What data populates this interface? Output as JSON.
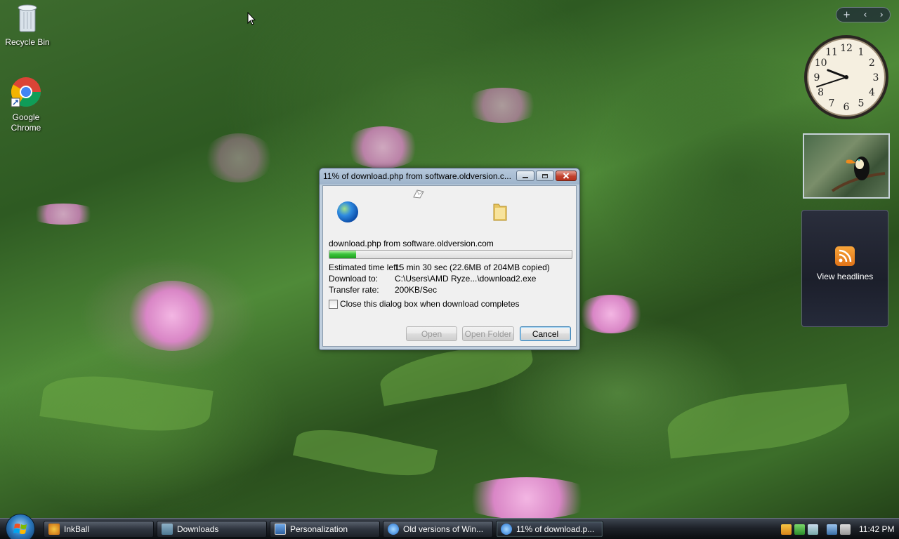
{
  "desktop": {
    "icons": [
      {
        "label": "Recycle Bin"
      },
      {
        "label": "Google Chrome"
      }
    ]
  },
  "gadgets": {
    "controls": {
      "add": "+",
      "prev": "‹",
      "next": "›"
    },
    "clock": {
      "hour": 9,
      "minute": 42,
      "numerals": [
        "12",
        "1",
        "2",
        "3",
        "4",
        "5",
        "6",
        "7",
        "8",
        "9",
        "10",
        "11"
      ]
    },
    "feeds": {
      "label": "View headlines"
    }
  },
  "dialog": {
    "title": "11% of download.php from software.oldversion.c...",
    "source": "download.php from software.oldversion.com",
    "progress": 0.11,
    "rows": [
      {
        "label": "Estimated time left:",
        "value": "15 min 30 sec (22.6MB of 204MB copied)"
      },
      {
        "label": "Download to:",
        "value": "C:\\Users\\AMD Ryze...\\download2.exe"
      },
      {
        "label": "Transfer rate:",
        "value": "200KB/Sec"
      }
    ],
    "checkbox_label": "Close this dialog box when download completes",
    "buttons": {
      "open": "Open",
      "open_folder": "Open Folder",
      "cancel": "Cancel"
    }
  },
  "taskbar": {
    "items": [
      {
        "label": "InkBall"
      },
      {
        "label": "Downloads"
      },
      {
        "label": "Personalization"
      },
      {
        "label": "Old versions of Win..."
      },
      {
        "label": "11% of download.p..."
      }
    ],
    "clock": "11:42 PM"
  },
  "colors": {
    "progress": "#3cc43c",
    "cancel_default_border": "#3c7fb1"
  }
}
